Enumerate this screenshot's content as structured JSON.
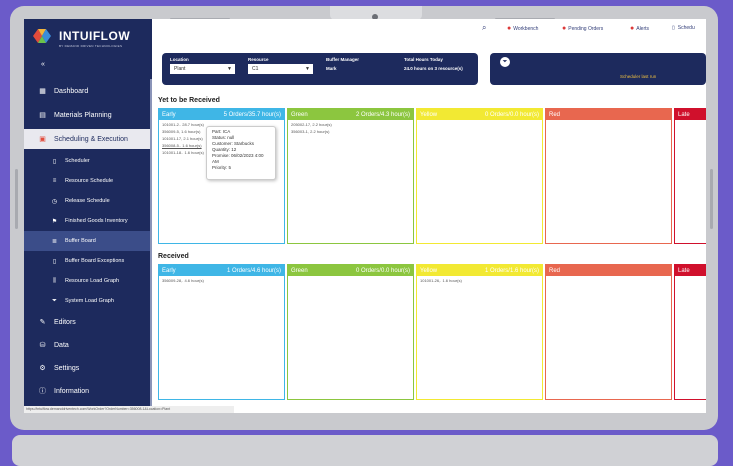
{
  "brand": {
    "name": "INTUIFLOW",
    "tagline": "BY DEMAND DRIVEN TECHNOLOGIES"
  },
  "sidebar": {
    "items": [
      {
        "label": "Dashboard",
        "icon": "grid"
      },
      {
        "label": "Materials Planning",
        "icon": "clipboard"
      },
      {
        "label": "Scheduling & Execution",
        "icon": "calendar"
      },
      {
        "label": "Scheduler",
        "icon": "doc"
      },
      {
        "label": "Resource Schedule",
        "icon": "boxes"
      },
      {
        "label": "Release Schedule",
        "icon": "clock"
      },
      {
        "label": "Finished Goods Inventory",
        "icon": "flag"
      },
      {
        "label": "Buffer Board",
        "icon": "layers"
      },
      {
        "label": "Buffer Board Exceptions",
        "icon": "doc"
      },
      {
        "label": "Resource Load Graph",
        "icon": "bars"
      },
      {
        "label": "System Load Graph",
        "icon": "funnel"
      },
      {
        "label": "Editors",
        "icon": "edit"
      },
      {
        "label": "Data",
        "icon": "db"
      },
      {
        "label": "Settings",
        "icon": "gear"
      },
      {
        "label": "Information",
        "icon": "info"
      }
    ]
  },
  "topbar": {
    "workbench": "Workbench",
    "pending_orders": "Pending Orders",
    "alerts": "Alerts",
    "schedule": "Schedu"
  },
  "filters": {
    "location_label": "Location",
    "location_value": "Plant",
    "resource_label": "Resource",
    "resource_value": "C1",
    "buffer_manager_label": "Buffer Manager",
    "buffer_manager_value": "Mark",
    "total_hours_label": "Total Hours Today",
    "total_hours_value": "24.0 hours on 3 resource(s)"
  },
  "info": {
    "text": "Scheduler last run"
  },
  "sections": {
    "to_receive": {
      "title": "Yet to be Received",
      "columns": [
        {
          "name": "Early",
          "summary": "5 Orders/35.7 hour(s)",
          "items": [
            "101001-2.. 28.7 hour(s)",
            "356009-5, 1.6 hour(s)",
            "101001-17, 2.1 hour(s)",
            "356008-5.. 1.6 hour(s)",
            "101001-18.. 1.6 hour(s)"
          ]
        },
        {
          "name": "Green",
          "summary": "2 Orders/4.3 hour(s)",
          "items": [
            "205002-17, 2.2 hour(s)",
            "356003-1, 2.2 hour(s)"
          ]
        },
        {
          "name": "Yellow",
          "summary": "0 Orders/0.0 hour(s)",
          "items": []
        },
        {
          "name": "Red",
          "summary": "",
          "items": []
        },
        {
          "name": "Late",
          "summary": "",
          "items": []
        }
      ]
    },
    "received": {
      "title": "Received",
      "columns": [
        {
          "name": "Early",
          "summary": "1 Orders/4.6 hour(s)",
          "items": [
            "356009-28,. 4.6 hour(s)"
          ]
        },
        {
          "name": "Green",
          "summary": "0 Orders/0.0 hour(s)",
          "items": []
        },
        {
          "name": "Yellow",
          "summary": "1 Orders/1.6 hour(s)",
          "items": [
            "101001-26,. 1.6 hour(s)"
          ]
        },
        {
          "name": "Red",
          "summary": "",
          "items": []
        },
        {
          "name": "Late",
          "summary": "",
          "items": []
        }
      ]
    }
  },
  "tooltip": {
    "part": "Part: ICA",
    "status": "Status: null",
    "customer": "Customer: Starbucks",
    "quantity": "Quantity: 12",
    "promise": "Promise: 06/02/2023 4:00 AM",
    "priority": "Priority: 5"
  },
  "status_url": "https://intuiflow.demanddriventech.com/WorkOrder?OrderNumber=356008-1&Location=Plant",
  "colors": {
    "early": "#3fb6e6",
    "green": "#8cc63f",
    "yellow": "#f2e933",
    "red": "#e8674f",
    "late": "#d0102c",
    "sidebar": "#1d2a5d",
    "background": "#6b5bc9"
  }
}
